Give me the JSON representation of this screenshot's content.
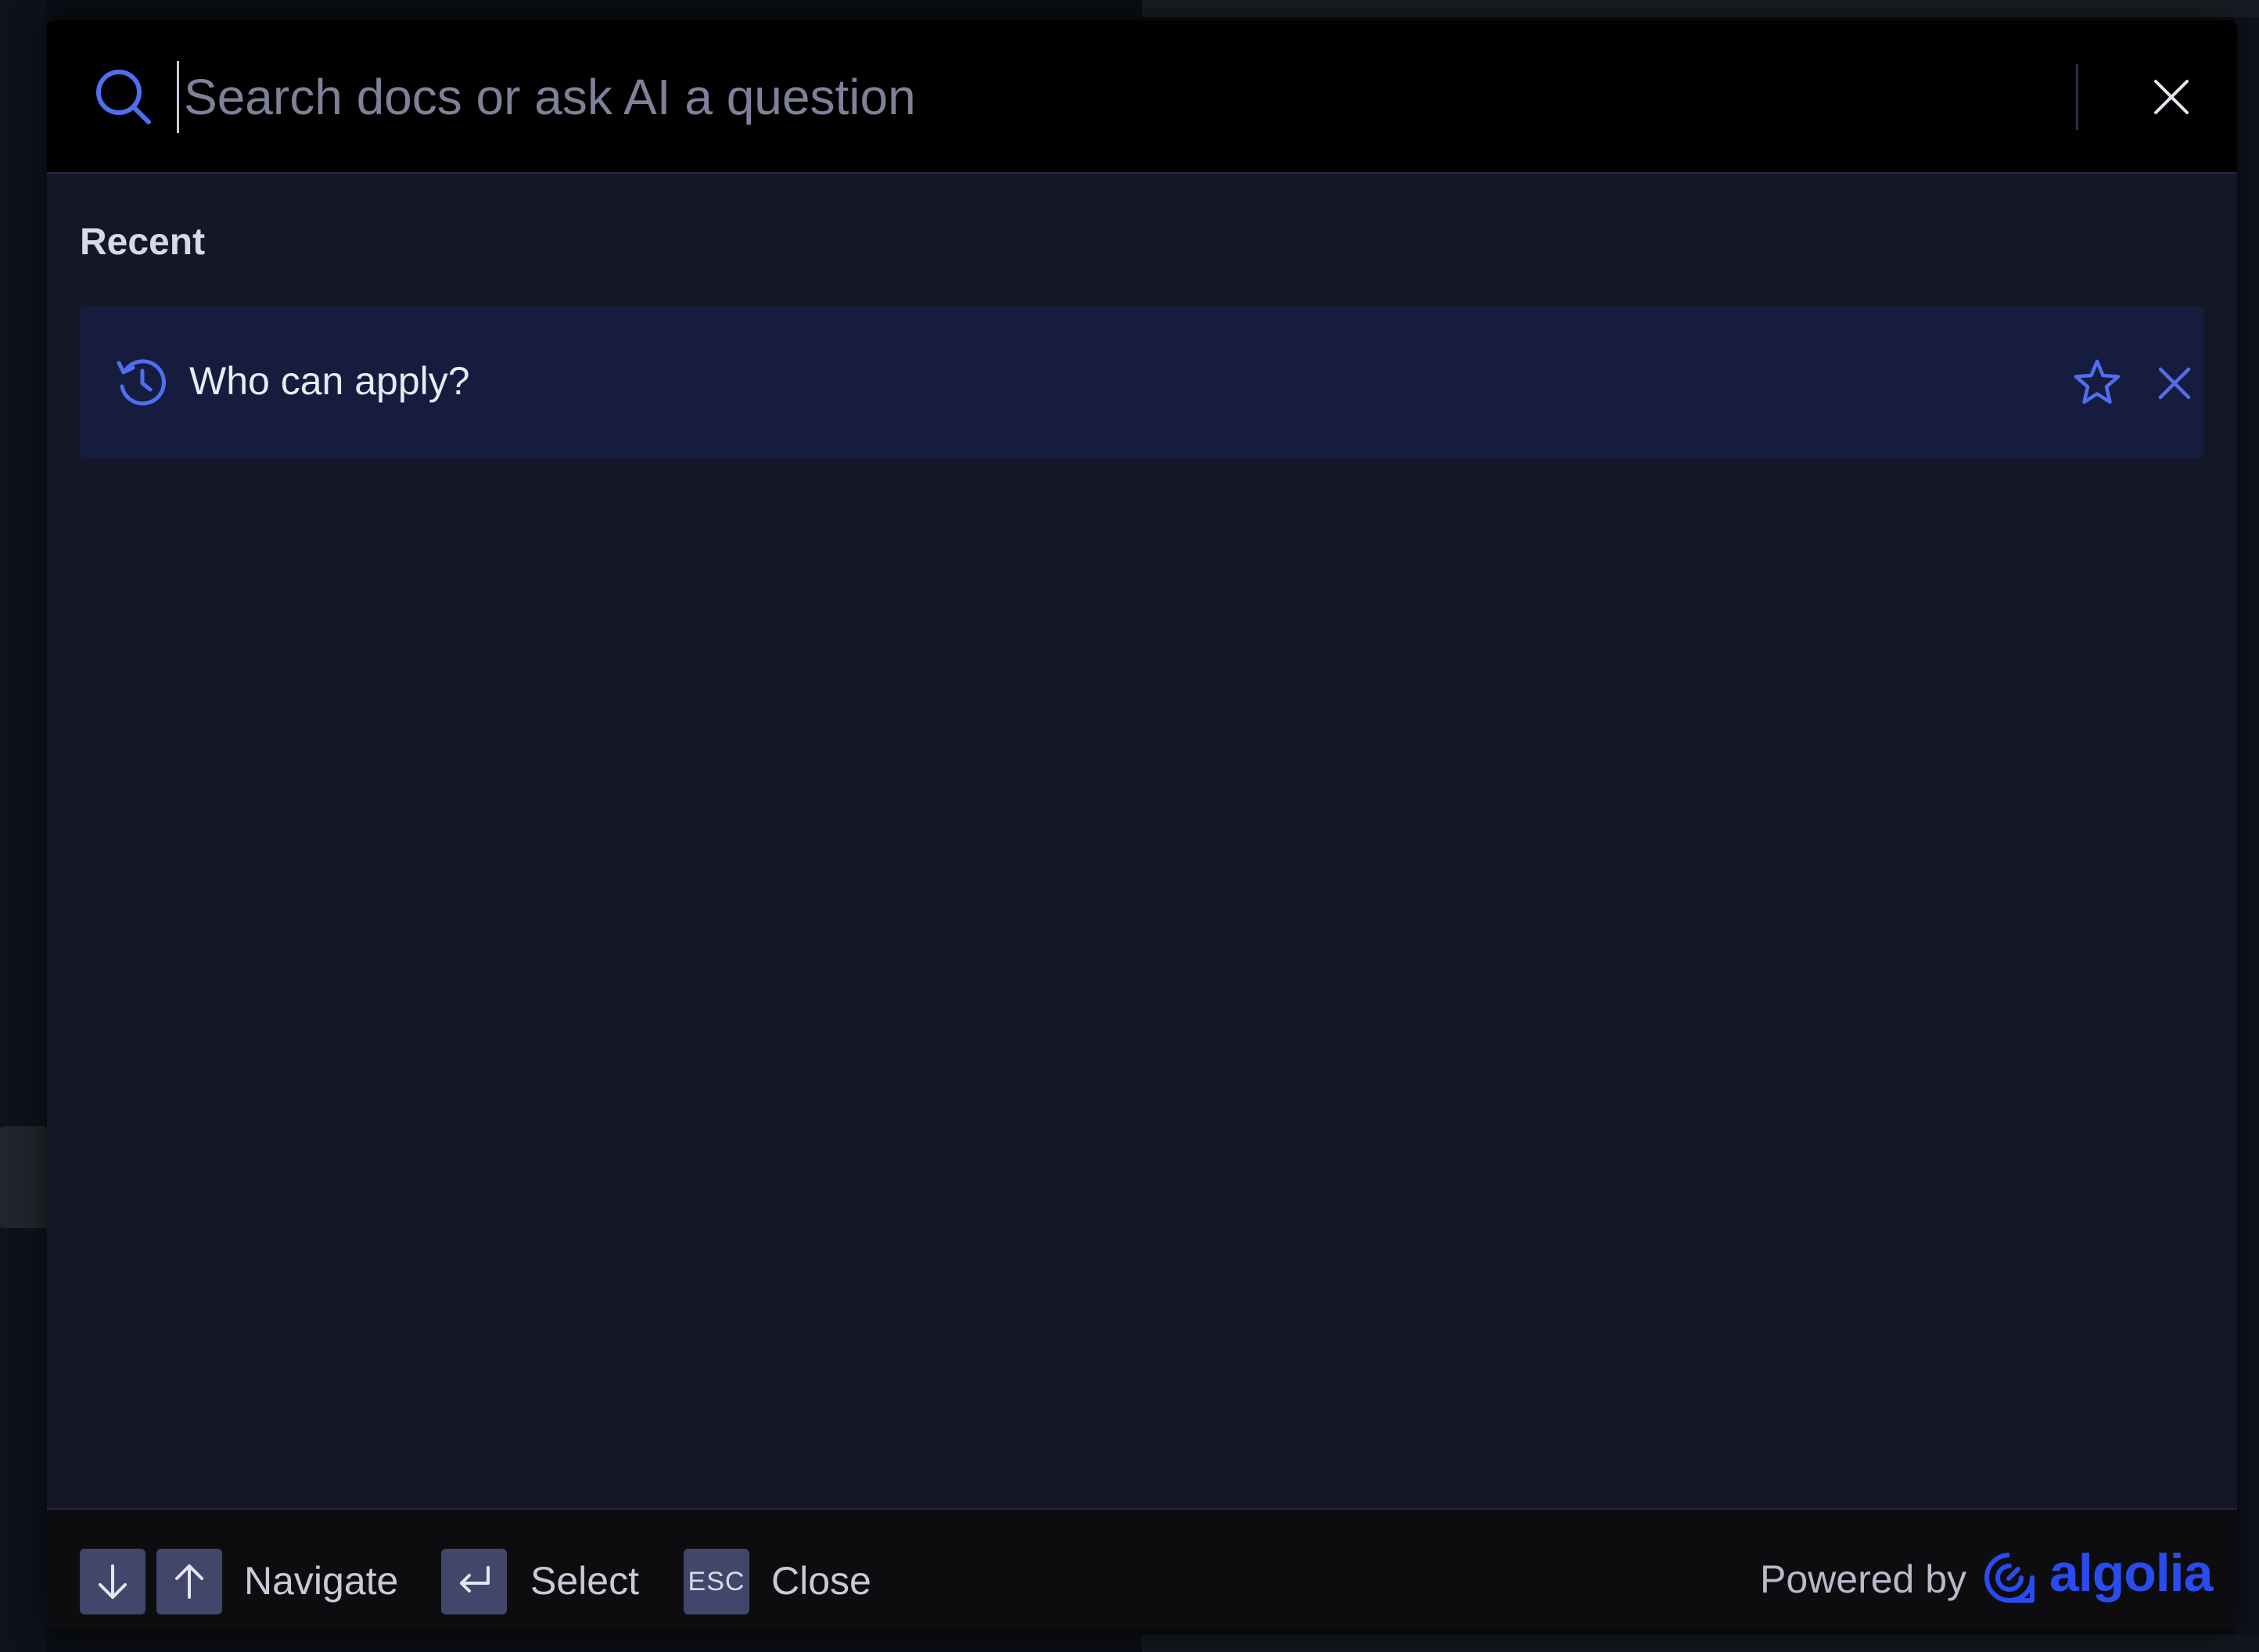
{
  "search": {
    "placeholder": "Search docs or ask AI a question",
    "value": ""
  },
  "recent": {
    "title": "Recent",
    "items": [
      {
        "label": "Who can apply?"
      }
    ]
  },
  "footer": {
    "navigate_label": "Navigate",
    "select_label": "Select",
    "esc_key": "ESC",
    "close_label": "Close",
    "powered_by": "Powered by",
    "brand": "algolia"
  },
  "colors": {
    "accent": "#4f6ef0",
    "brand": "#2a4bf0",
    "modal_bg": "#151728",
    "selected_item_bg": "#161c3e",
    "key_bg": "#42466a"
  },
  "icons": {
    "search": "search-icon",
    "close": "close-icon",
    "history": "history-icon",
    "star": "star-icon",
    "remove": "close-icon",
    "arrow_down": "arrow-down-icon",
    "arrow_up": "arrow-up-icon",
    "enter": "enter-icon",
    "algolia": "algolia-logo"
  }
}
